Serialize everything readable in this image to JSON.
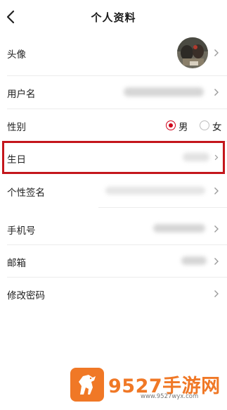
{
  "header": {
    "title": "个人资料"
  },
  "rows": {
    "avatar": {
      "label": "头像"
    },
    "username": {
      "label": "用户名"
    },
    "gender": {
      "label": "性别",
      "options": [
        "男",
        "女"
      ],
      "selected": "男"
    },
    "birthday": {
      "label": "生日"
    },
    "signature": {
      "label": "个性签名"
    },
    "phone": {
      "label": "手机号"
    },
    "email": {
      "label": "邮箱"
    },
    "password": {
      "label": "修改密码"
    }
  },
  "watermark": {
    "brand": "9527手游网",
    "url": "www.9527wyx.com"
  },
  "colors": {
    "accent": "#d0021b",
    "highlight_border": "#c4161c",
    "watermark": "#f07826",
    "divider": "#ececec"
  },
  "icons": [
    "back-arrow-icon",
    "chevron-right-icon",
    "horse-logo-icon"
  ]
}
